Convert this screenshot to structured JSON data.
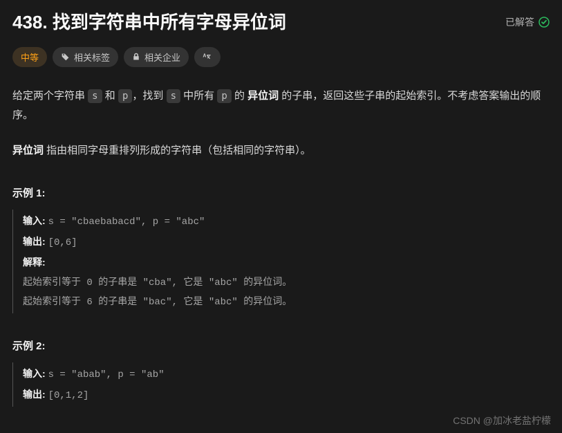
{
  "header": {
    "title": "438. 找到字符串中所有字母异位词",
    "status_text": "已解答"
  },
  "tags": {
    "difficulty": "中等",
    "related_tags": "相关标签",
    "related_companies": "相关企业"
  },
  "description": {
    "p1_part1": "给定两个字符串 ",
    "p1_code1": "s",
    "p1_part2": " 和 ",
    "p1_code2": "p",
    "p1_part3": "，找到 ",
    "p1_code3": "s",
    "p1_part4": " 中所有 ",
    "p1_code4": "p",
    "p1_part5": " 的 ",
    "p1_bold": "异位词",
    "p1_part6": " 的子串，返回这些子串的起始索引。不考虑答案输出的顺序。",
    "p2_bold": "异位词",
    "p2_rest": " 指由相同字母重排列形成的字符串（包括相同的字符串）。"
  },
  "examples": {
    "ex1": {
      "title": "示例 1:",
      "input_label": "输入: ",
      "input_value": "s = \"cbaebabacd\", p = \"abc\"",
      "output_label": "输出: ",
      "output_value": "[0,6]",
      "explain_label": "解释:",
      "explain_line1": "起始索引等于 0 的子串是 \"cba\", 它是 \"abc\" 的异位词。",
      "explain_line2": "起始索引等于 6 的子串是 \"bac\", 它是 \"abc\" 的异位词。"
    },
    "ex2": {
      "title": "示例 2:",
      "input_label": "输入: ",
      "input_value": "s = \"abab\", p = \"ab\"",
      "output_label": "输出: ",
      "output_value": "[0,1,2]"
    }
  },
  "watermark": "CSDN @加冰老盐柠檬"
}
